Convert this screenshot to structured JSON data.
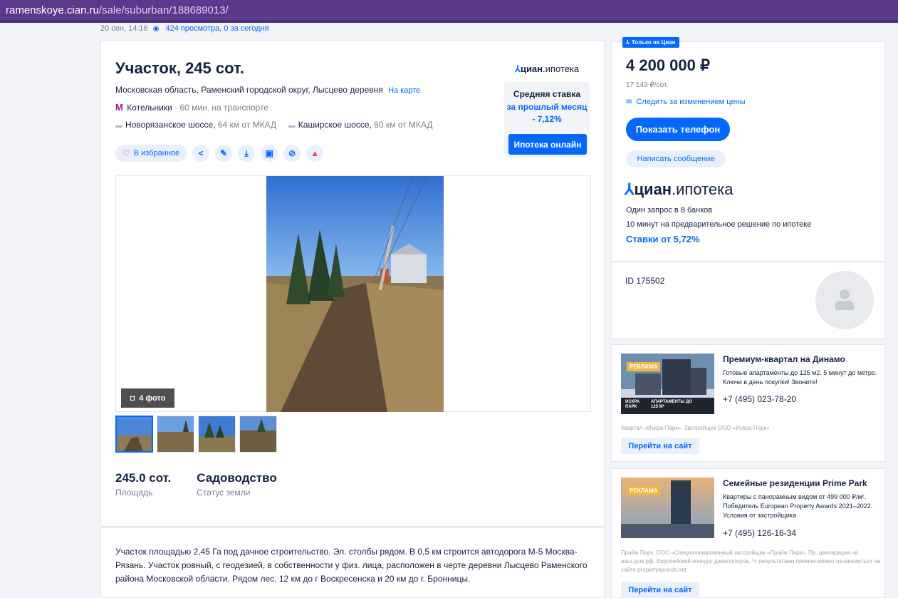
{
  "browser": {
    "url_host": "ramenskoye.cian.ru",
    "url_path": "/sale/suburban/188689013/"
  },
  "meta": {
    "date": "20 сен, 14:16",
    "views": "424 просмотра, 0 за сегодня"
  },
  "listing": {
    "title": "Участок, 245 сот.",
    "address": "Московская область, Раменский городской округ, Лысцево деревня",
    "map_link": "На карте",
    "metro_name": "Котельники",
    "metro_time": "· 60 мин. на транспорте",
    "road1_name": "Новорязанское шоссе,",
    "road1_dist": "64 км от МКАД",
    "road2_name": "Каширское шоссе,",
    "road2_dist": "80 км от МКАД",
    "favorite_label": "В избранное",
    "photo_count": "4 фото",
    "specs": [
      {
        "value": "245.0 сот.",
        "label": "Площадь"
      },
      {
        "value": "Садоводство",
        "label": "Статус земли"
      }
    ],
    "description": "Участок площадью 2,45 Га под дачное строительство. Эл. столбы рядом. В 0,5 км строится автодорога М-5 Москва-Рязань. Участок ровный, с геодезией, в собственности у физ. лица, расположен в черте деревни Лысцево Раменского района Московской области. Рядом лес. 12 км до г Воскресенска и 20 км до г. Бронницы."
  },
  "mortgage_widget": {
    "logo_main": "циан",
    "logo_sub": ".ипотека",
    "line1": "Средняя ставка",
    "line2": "за прошлый месяц - 7,12%",
    "button": "Ипотека онлайн"
  },
  "price_panel": {
    "badge": "Только на Циан",
    "price": "4 200 000 ₽",
    "per_unit": "17 143 ₽/сот.",
    "follow": "Следить за изменением цены",
    "phone_button": "Показать телефон",
    "message_button": "Написать сообщение",
    "logo_main": "циан",
    "logo_sub": ".ипотека",
    "mortgage_line1": "Один запрос в 8 банков",
    "mortgage_line2": "10 минут на предварительное решение по ипотеке",
    "rates": "Ставки от 5,72%"
  },
  "agent": {
    "id": "ID 175502"
  },
  "ads": [
    {
      "tag": "РЕКЛАМА",
      "cap_left": "ИСКРА ПАРК",
      "cap_right": "АПАРТАМЕНТЫ ДО 125 М²",
      "title": "Премиум-квартал на Динамо",
      "text": "Готовые апартаменты до 125 м2. 5 минут до метро. Ключи в день покупки! Звоните!",
      "phone": "+7 (495) 023-78-20",
      "disclaimer": "Квартал «Искра-Парк». Застройщик ООО «Искра-Парк»",
      "button": "Перейти на сайт"
    },
    {
      "tag": "РЕКЛАМА",
      "title": "Семейные резиденции Prime Park",
      "text": "Квартиры с панорамным видом от 499 000 ₽/м². Победитель European Property Awards 2021–2022. Условия от застройщика",
      "phone": "+7 (495) 126-16-34",
      "disclaimer": "Прайм Парк. ООО «Специализированный застройщик «Прайм Парк». Пр. декларация на наш.дом.рф. Европейский конкурс девелоперов. *с результатами премии можно ознакомиться на сайте propertyawards.net",
      "button": "Перейти на сайт"
    }
  ],
  "colors": {
    "accent": "#0468ff",
    "text": "#152242",
    "metro": "#a7168b",
    "browser_bar": "#5b3a8c"
  }
}
